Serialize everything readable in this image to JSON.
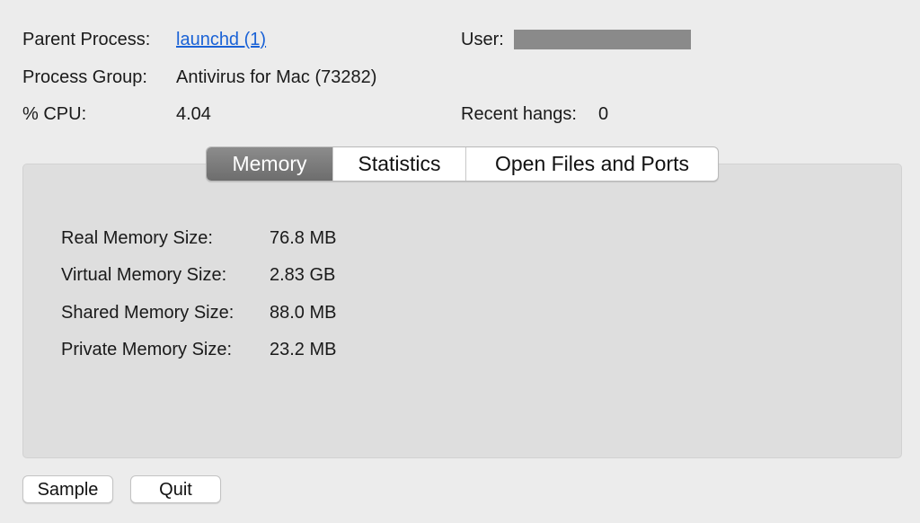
{
  "info": {
    "parent_process_label": "Parent Process:",
    "parent_process_value": "launchd (1)",
    "process_group_label": "Process Group:",
    "process_group_value": "Antivirus for Mac (73282)",
    "cpu_label": "% CPU:",
    "cpu_value": "4.04",
    "user_label": "User:",
    "recent_hangs_label": "Recent hangs:",
    "recent_hangs_value": "0"
  },
  "tabs": [
    {
      "label": "Memory",
      "active": true
    },
    {
      "label": "Statistics",
      "active": false
    },
    {
      "label": "Open Files and Ports",
      "active": false
    }
  ],
  "memory": [
    {
      "label": "Real Memory Size:",
      "value": "76.8 MB"
    },
    {
      "label": "Virtual Memory Size:",
      "value": "2.83 GB"
    },
    {
      "label": "Shared Memory Size:",
      "value": "88.0 MB"
    },
    {
      "label": "Private Memory Size:",
      "value": "23.2 MB"
    }
  ],
  "buttons": {
    "sample": "Sample",
    "quit": "Quit"
  },
  "colors": {
    "link": "#1a62d6",
    "active_tab": "#7a7a7a",
    "redaction": "#8a8a8a"
  }
}
